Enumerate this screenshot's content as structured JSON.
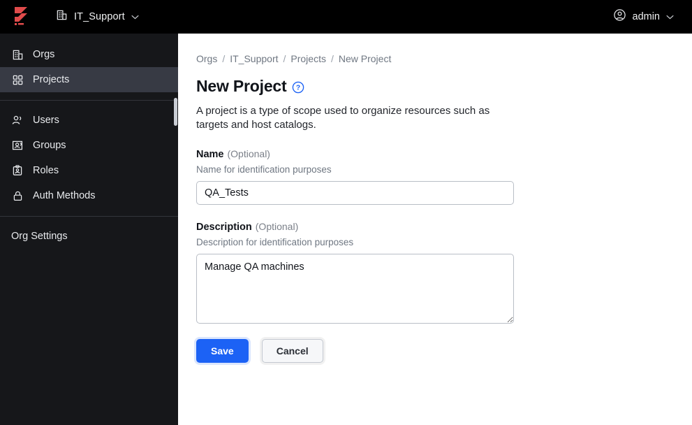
{
  "topbar": {
    "logo_name": "boundary-logo",
    "org_switcher": {
      "label": "IT_Support",
      "icon": "building-icon",
      "chevron": "chevron-down-icon"
    },
    "user_menu": {
      "label": "admin",
      "icon": "user-circle-icon",
      "chevron": "chevron-down-icon"
    }
  },
  "sidebar": {
    "primary_items": [
      {
        "label": "Orgs",
        "icon": "building-icon",
        "active": false
      },
      {
        "label": "Projects",
        "icon": "grid-icon",
        "active": true
      }
    ],
    "secondary_items": [
      {
        "label": "Users",
        "icon": "users-icon",
        "active": false
      },
      {
        "label": "Groups",
        "icon": "groups-icon",
        "active": false
      },
      {
        "label": "Roles",
        "icon": "roles-badge-icon",
        "active": false
      },
      {
        "label": "Auth Methods",
        "icon": "lock-icon",
        "active": false
      }
    ],
    "footer_items": [
      {
        "label": "Org Settings",
        "icon": "",
        "active": false
      }
    ]
  },
  "breadcrumb": {
    "items": [
      "Orgs",
      "IT_Support",
      "Projects",
      "New Project"
    ],
    "separator": "/"
  },
  "page": {
    "title": "New Project",
    "help_icon": "help-circle-icon",
    "description": "A project is a type of scope used to organize resources such as targets and host catalogs."
  },
  "form": {
    "name_field": {
      "label": "Name",
      "optional": "(Optional)",
      "help": "Name for identification purposes",
      "value": "QA_Tests",
      "placeholder": ""
    },
    "description_field": {
      "label": "Description",
      "optional": "(Optional)",
      "help": "Description for identification purposes",
      "value": "Manage QA machines",
      "placeholder": ""
    },
    "save_label": "Save",
    "cancel_label": "Cancel"
  },
  "colors": {
    "accent_blue": "#1c62f5",
    "logo_red": "#e04b4b",
    "sidebar_bg": "#16171a",
    "sidebar_active": "#373a44",
    "topbar_bg": "#000000"
  }
}
